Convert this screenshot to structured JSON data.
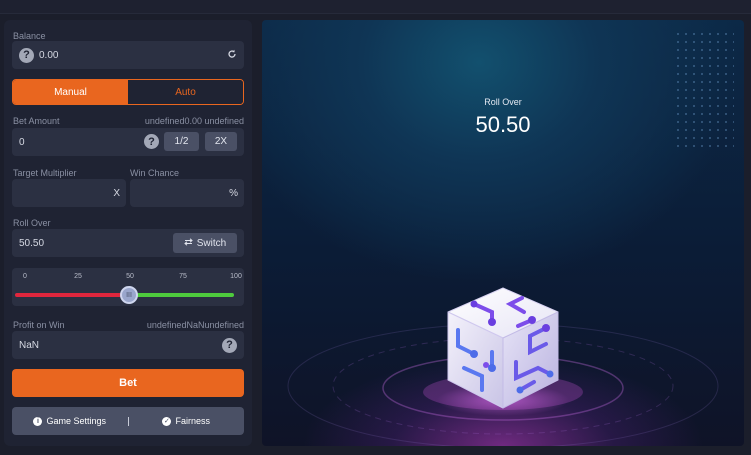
{
  "balance": {
    "label": "Balance",
    "value": "0.00"
  },
  "mode_tabs": [
    {
      "label": "Manual",
      "active": true
    },
    {
      "label": "Auto",
      "active": false
    }
  ],
  "bet_amount": {
    "label": "Bet Amount",
    "right_label": "undefined0.00 undefined",
    "value": "0",
    "half_label": "1/2",
    "double_label": "2X"
  },
  "target_multiplier": {
    "label": "Target Multiplier",
    "value": "",
    "suffix": "X"
  },
  "win_chance": {
    "label": "Win Chance",
    "value": "",
    "suffix": "%"
  },
  "roll_over_field": {
    "label": "Roll Over",
    "value": "50.50",
    "switch_label": "Switch"
  },
  "slider": {
    "ticks": [
      "0",
      "25",
      "50",
      "75",
      "100"
    ],
    "value": 50.5,
    "min": 0,
    "max": 100,
    "lose_color": "#e0263d",
    "win_color": "#4ecb3d",
    "knob_glyph": "III"
  },
  "profit_on_win": {
    "label": "Profit on Win",
    "right_label": "undefinedNaNundefined",
    "value": "NaN"
  },
  "bet_button": {
    "label": "Bet"
  },
  "footer": {
    "game_settings_label": "Game Settings",
    "fairness_label": "Fairness",
    "separator": "|"
  },
  "display": {
    "label": "Roll Over",
    "value": "50.50"
  },
  "colors": {
    "accent": "#e9661f",
    "panel": "#1f2333",
    "field": "#2b3042",
    "button": "#4a5065"
  },
  "icons": {
    "refresh": "refresh-icon",
    "help": "question-icon",
    "switch": "swap-arrows-icon",
    "info": "info-icon",
    "check": "check-circle-icon",
    "dice": "dice-icon"
  }
}
